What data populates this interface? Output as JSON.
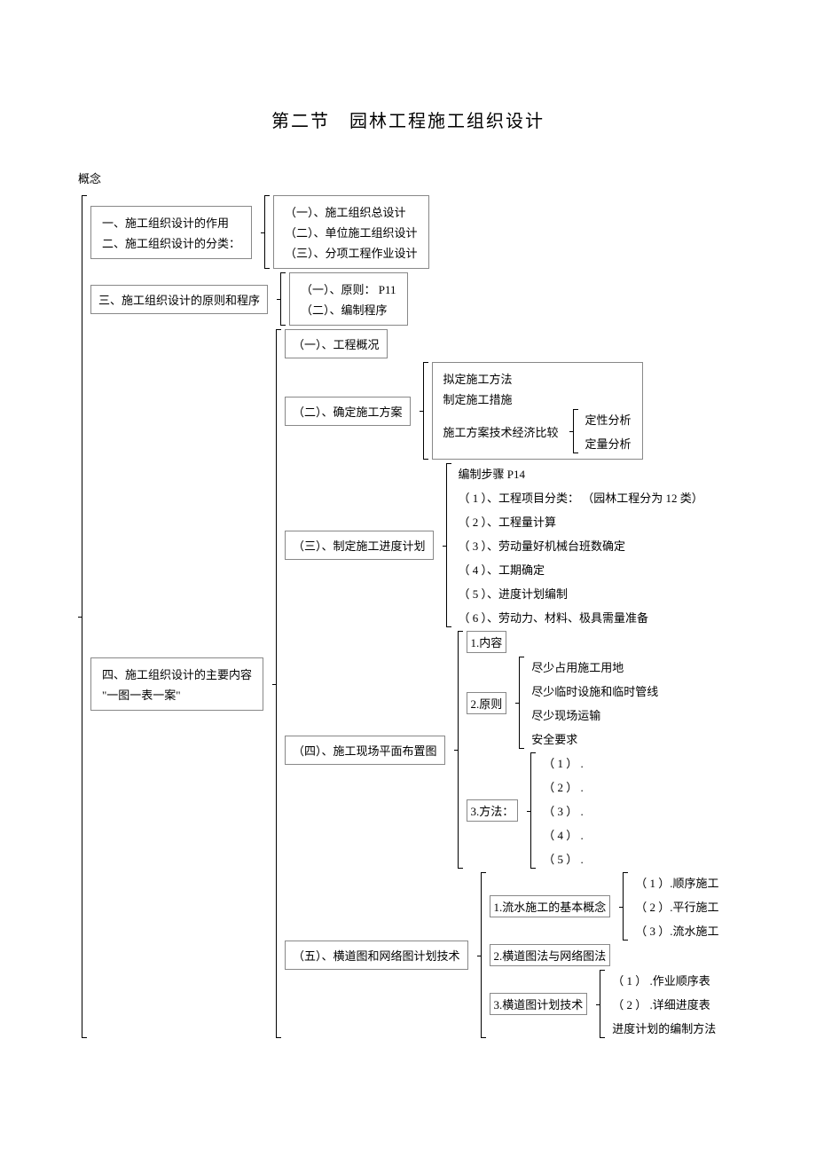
{
  "title": "第二节　园林工程施工组织设计",
  "root": "概念",
  "sec1": {
    "line1": "一、施工组织设计的作用",
    "line2": "二、施工组织设计的分类：",
    "c1": "（一）、施工组织总设计",
    "c2": "（二）、单位施工组织设计",
    "c3": "（三）、分项工程作业设计"
  },
  "sec3": {
    "label": "三、施工组织设计的原则和程序",
    "c1": "（一）、原则： P11",
    "c2": "（二）、编制程序"
  },
  "sec4": {
    "label1": "四、施工组织设计的主要内容",
    "label2": "\"一图一表一案\"",
    "s1": "（一）、工程概况",
    "s2": {
      "label": "（二）、确定施工方案",
      "a": "拟定施工方法",
      "b": "制定施工措施",
      "c": "施工方案技术经济比较",
      "d1": "定性分析",
      "d2": "定量分析"
    },
    "s3": {
      "label": "（三）、制定施工进度计划",
      "head": "编制步骤 P14",
      "i1": "（ 1 ）、工程项目分类：  （园林工程分为 12 类）",
      "i2": "（ 2 ）、工程量计算",
      "i3": "（ 3 ）、劳动量好机械台班数确定",
      "i4": "（ 4 ）、工期确定",
      "i5": "（ 5 ）、进度计划编制",
      "i6": "（ 6 ）、劳动力、材料、极具需量准备"
    },
    "s4": {
      "label": "（四）、施工现场平面布置图",
      "p1": "1.内容",
      "p2": "2.原则",
      "p2a": "尽少占用施工用地",
      "p2b": "尽少临时设施和临时管线",
      "p2c": "尽少现场运输",
      "p2d": "安全要求",
      "p3": "3.方法：",
      "m1": "（ 1 ） .",
      "m2": "（ 2 ） .",
      "m3": "（ 3 ） .",
      "m4": "（ 4 ） .",
      "m5": "（ 5 ） ."
    },
    "s5": {
      "label": "（五）、横道图和网络图计划技术",
      "q1": "1.流水施工的基本概念",
      "q1a": "（ 1 ）.顺序施工",
      "q1b": "（ 2 ）.平行施工",
      "q1c": "（ 3 ）.流水施工",
      "q2": "2.横道图法与网络图法",
      "q3": "3.横道图计划技术",
      "q3a": "（ 1 ） .作业顺序表",
      "q3b": "（ 2 ） .详细进度表",
      "q3c": "进度计划的编制方法"
    }
  }
}
